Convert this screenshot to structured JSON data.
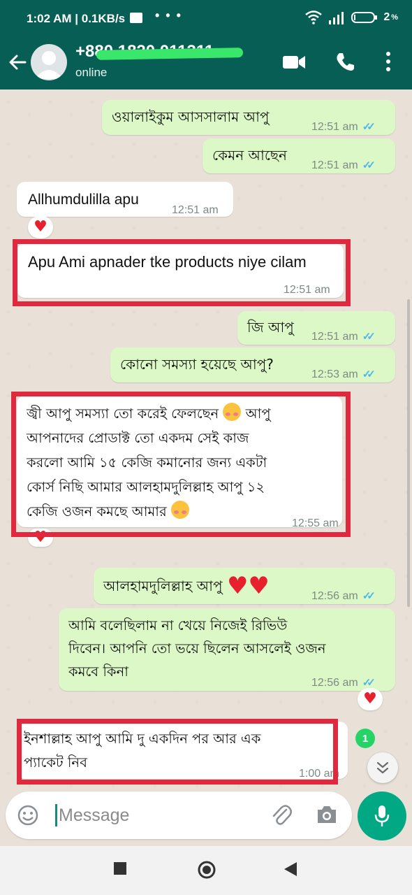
{
  "status_bar": {
    "time_speed": "1:02 AM | 0.1KB/s",
    "battery": "2"
  },
  "header": {
    "contact_name": "+880 1820 011311",
    "status": "online"
  },
  "messages": [
    {
      "text": "ওয়ালাইকুম আসসালাম আপু",
      "time": "12:51 am"
    },
    {
      "text": "কেমন আছেন",
      "time": "12:51 am"
    },
    {
      "text": "Allhumdulilla apu",
      "time": "12:51 am"
    },
    {
      "text": "Apu Ami apnader tke products niye cilam",
      "time": "12:51 am"
    },
    {
      "text": "জি আপু",
      "time": "12:51 am"
    },
    {
      "text": "কোনো সমস্যা হয়েছে আপু?",
      "time": "12:53 am"
    },
    {
      "lines": [
        "জ্বী আপু সমস্যা তো করেই ফেলছেন",
        "আপনাদের প্রোডাক্ট তো একদম সেই কাজ",
        "করলো আমি ১৫ কেজি কমানোর জন্য একটা",
        "কোর্স নিছি আমার আলহামদুলিল্লাহ আপু ১২",
        "কেজি ওজন কমছে আমার"
      ],
      "tail": "আপু",
      "time": "12:55 am"
    },
    {
      "text": "আলহামদুলিল্লাহ আপু",
      "time": "12:56 am"
    },
    {
      "lines": [
        "আমি বলেছিলাম না খেয়ে নিজেই রিভিউ",
        "দিবেন। আপনি তো ভয়ে ছিলেন আসলেই ওজন",
        "কমবে কিনা"
      ],
      "time": "12:56 am"
    },
    {
      "lines": [
        "ইনশাল্লাহ আপু আমি দু একদিন পর আর এক",
        "প্যাকেট নিব"
      ],
      "time": "1:00 am"
    }
  ],
  "unread_count": "1",
  "composer": {
    "placeholder": "Message"
  },
  "icons": [
    "back-arrow-icon",
    "video-call-icon",
    "phone-icon",
    "more-icon",
    "emoji-icon",
    "attach-icon",
    "camera-icon",
    "mic-icon",
    "heart-icon",
    "chevron-down-icon"
  ],
  "colors": {
    "header": "#075e54",
    "outgoing": "#dcf8c6",
    "incoming": "#ffffff",
    "highlight": "#e0283e",
    "tick": "#4fb6ec",
    "mic": "#00a884"
  }
}
